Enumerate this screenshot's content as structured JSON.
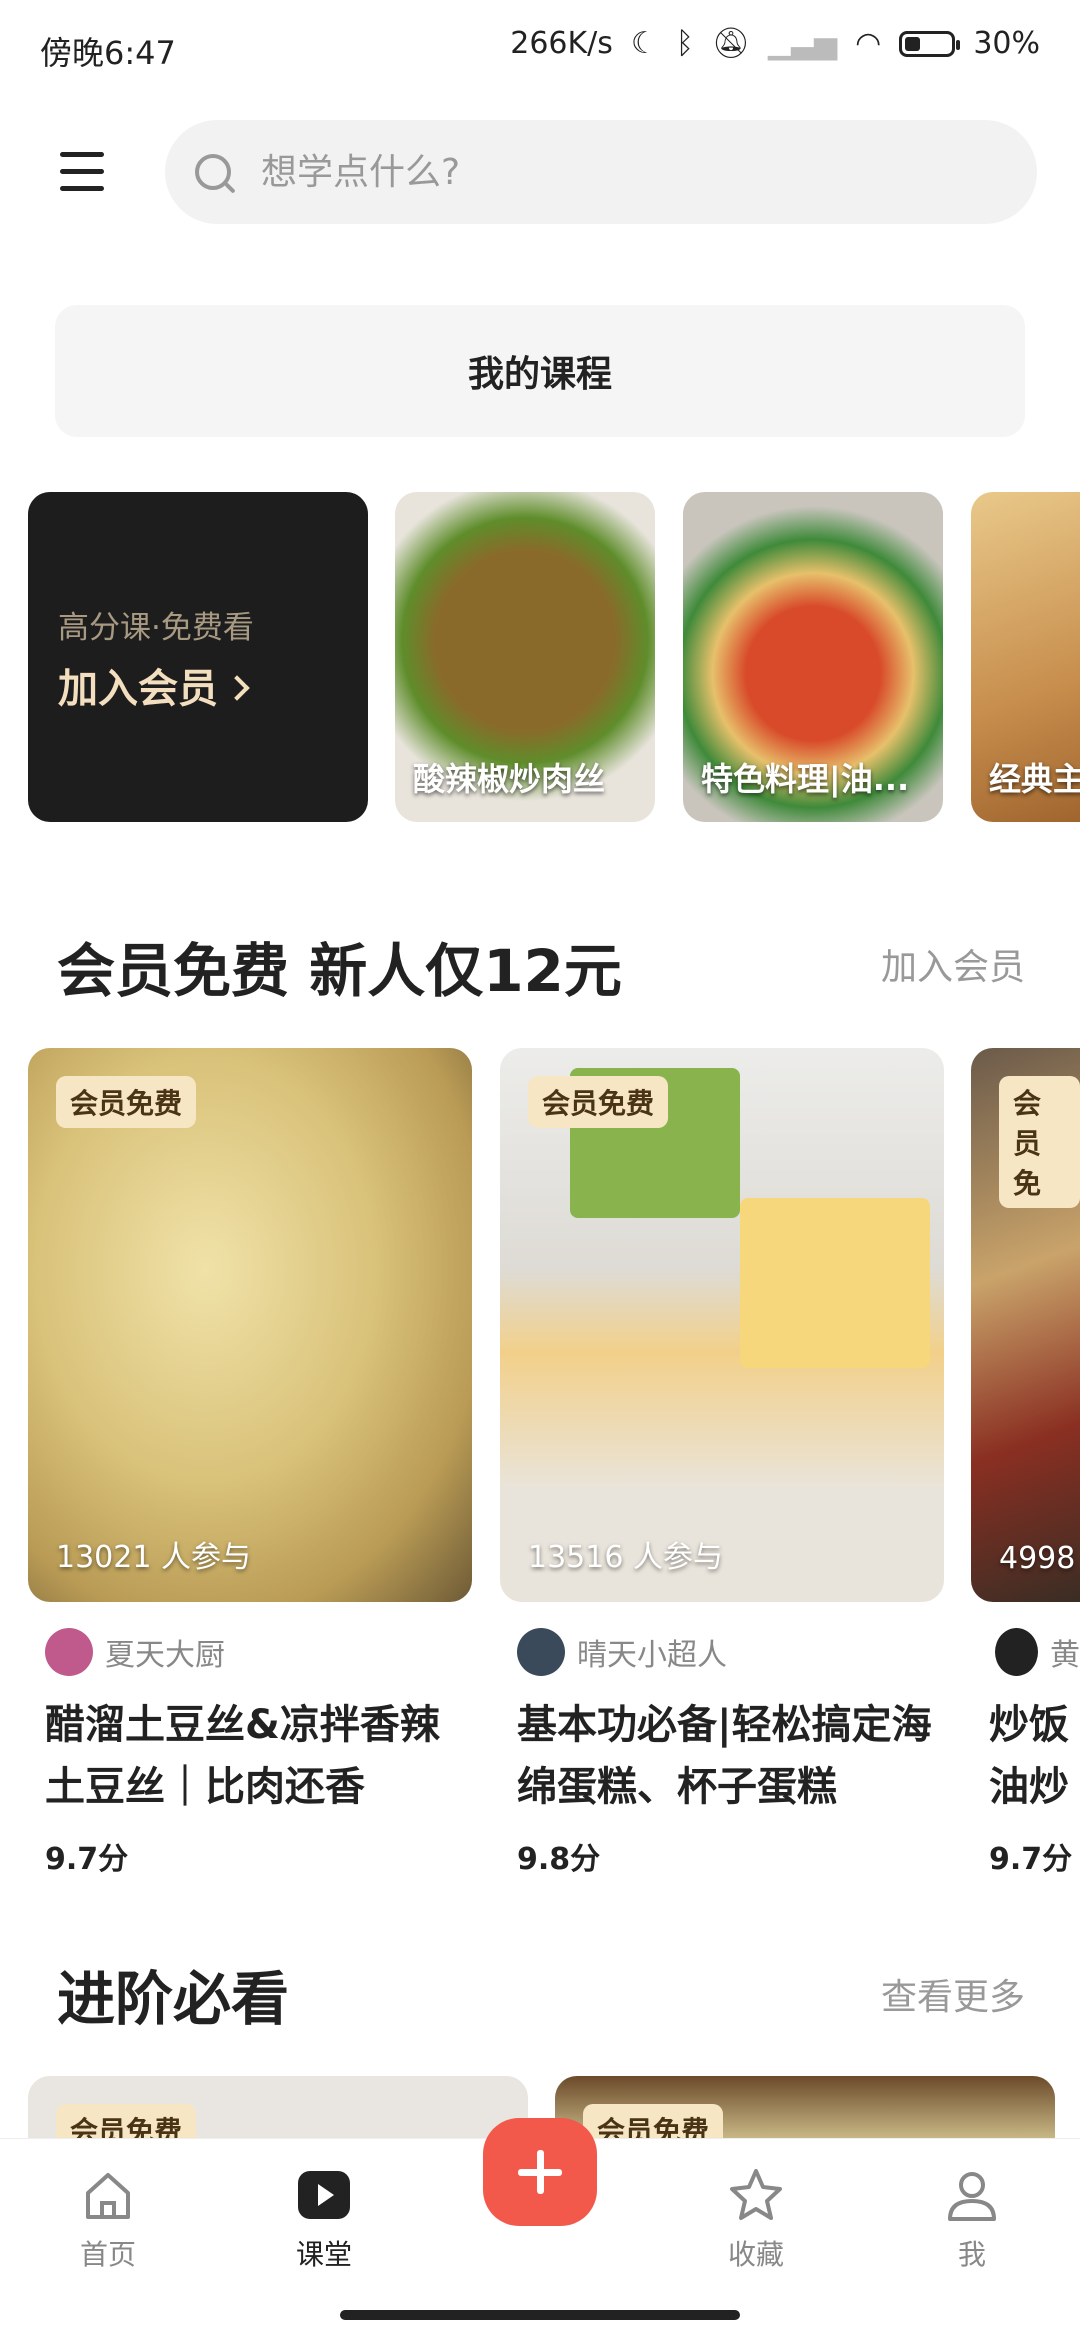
{
  "status": {
    "time": "傍晚6:47",
    "network_speed": "266K/s",
    "battery": "30%"
  },
  "header": {
    "search_placeholder": "想学点什么?"
  },
  "my_course_label": "我的课程",
  "promo": {
    "subtitle": "高分课·免费看",
    "title": "加入会员"
  },
  "thumbs": [
    {
      "label": "酸辣椒炒肉丝"
    },
    {
      "label": "特色料理|油..."
    },
    {
      "label": "经典主"
    }
  ],
  "section1": {
    "title": "会员免费 新人仅12元",
    "link": "加入会员"
  },
  "courses": [
    {
      "badge": "会员免费",
      "participants": "13021 人参与",
      "author": "夏天大厨",
      "title": "醋溜土豆丝&凉拌香辣土豆丝｜比肉还香",
      "score": "9.7分"
    },
    {
      "badge": "会员免费",
      "participants": "13516 人参与",
      "author": "晴天小超人",
      "title": "基本功必备|轻松搞定海绵蛋糕、杯子蛋糕",
      "score": "9.8分"
    },
    {
      "badge": "会员免",
      "participants": "4998",
      "author": "黄",
      "title": "炒饭油炒",
      "score": "9.7分"
    }
  ],
  "section2": {
    "title": "进阶必看",
    "link": "查看更多"
  },
  "bottom_cards": [
    {
      "badge": "会员免费"
    },
    {
      "badge": "会员免费"
    }
  ],
  "tabs": [
    {
      "label": "首页"
    },
    {
      "label": "课堂"
    },
    {
      "label": "收藏"
    },
    {
      "label": "我"
    }
  ]
}
